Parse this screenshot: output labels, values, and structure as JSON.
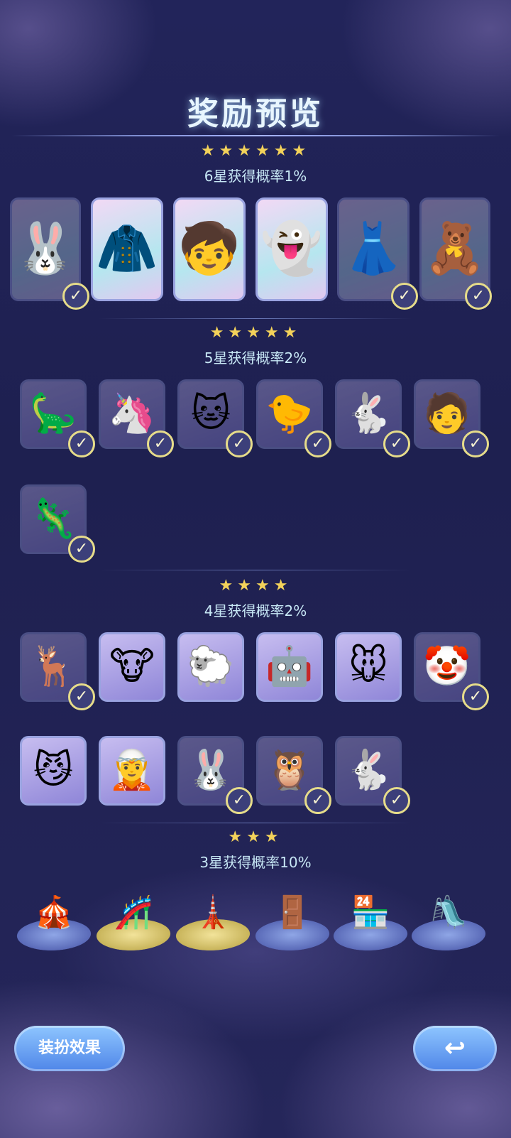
{
  "title": "奖励预览",
  "tiers": {
    "six": {
      "stars": "★★★★★★",
      "label": "6星获得概率1%"
    },
    "five": {
      "stars": "★★★★★",
      "label": "5星获得概率2%"
    },
    "four": {
      "stars": "★★★★",
      "label": "4星获得概率2%"
    },
    "three": {
      "stars": "★★★",
      "label": "3星获得概率10%"
    }
  },
  "icons": {
    "check": "✓",
    "six_star": [
      "bunny-hood-costume-icon",
      "green-raincoat-costume-icon",
      "star-pajama-costume-icon",
      "white-ghost-costume-icon",
      "lace-dress-costume-icon",
      "pink-jumpsuit-costume-icon"
    ],
    "five_star": [
      "dinosaur-mask-icon",
      "unicorn-mask-icon",
      "lynx-mask-icon",
      "duck-mask-icon",
      "party-bunny-mask-icon",
      "cyan-hair-mask-icon",
      "lizard-mask-icon"
    ],
    "four_star": [
      "elf-deer-mask-icon",
      "cow-mask-icon",
      "sheep-mask-icon",
      "steampunk-mask-icon",
      "pink-mouse-mask-icon",
      "jester-mask-icon",
      "cat-mask-icon",
      "antler-mask-icon",
      "blue-bunny-mask-icon",
      "tophat-owl-mask-icon",
      "clown-bunny-mask-icon"
    ],
    "three_star": [
      "circus-tent-icon",
      "rollercoaster-icon",
      "tower-icon",
      "booth-icon",
      "shop-icon",
      "slide-icon"
    ]
  },
  "buttons": {
    "outfit": "装扮效果",
    "back": "↩"
  }
}
